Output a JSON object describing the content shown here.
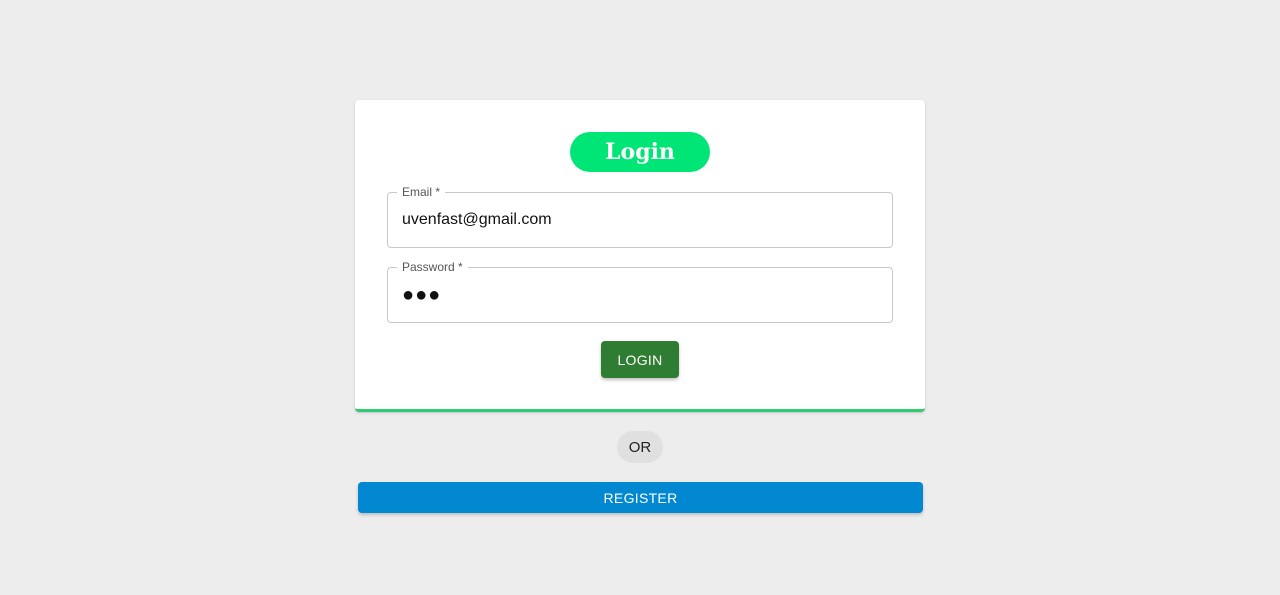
{
  "form": {
    "title": "Login",
    "email": {
      "label": "Email *",
      "value": "uvenfast@gmail.com"
    },
    "password": {
      "label": "Password *",
      "value": "●●●"
    },
    "login_label": "LOGIN"
  },
  "divider_label": "OR",
  "register_label": "REGISTER",
  "colors": {
    "background": "#ededed",
    "title_pill": "#00e676",
    "login_button": "#2e7d32",
    "card_accent": "#2ecc71",
    "register_button": "#0288d1"
  }
}
